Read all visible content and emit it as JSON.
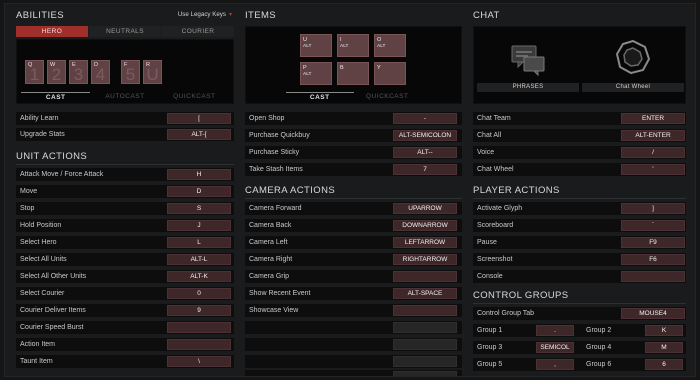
{
  "abilities": {
    "title": "ABILITIES",
    "legacy_label": "Use Legacy Keys",
    "tabs": [
      "HERO",
      "NEUTRALS",
      "COURIER"
    ],
    "slots": [
      {
        "key": "Q",
        "num": "1"
      },
      {
        "key": "W",
        "num": "2"
      },
      {
        "key": "E",
        "num": "3"
      },
      {
        "key": "D",
        "num": "4"
      },
      {
        "key": "F",
        "num": "5"
      },
      {
        "key": "R",
        "num": "U"
      }
    ],
    "modes": [
      "CAST",
      "AUTOCAST",
      "QUICKCAST"
    ],
    "rows": [
      {
        "label": "Ability Learn",
        "key": "["
      },
      {
        "label": "Upgrade Stats",
        "key": "ALT-["
      }
    ]
  },
  "unit_actions": {
    "title": "UNIT ACTIONS",
    "rows": [
      {
        "label": "Attack Move / Force Attack",
        "key": "H"
      },
      {
        "label": "Move",
        "key": "D"
      },
      {
        "label": "Stop",
        "key": "S"
      },
      {
        "label": "Hold Position",
        "key": "J"
      },
      {
        "label": "Select Hero",
        "key": "L"
      },
      {
        "label": "Select All Units",
        "key": "ALT-L"
      },
      {
        "label": "Select All Other Units",
        "key": "ALT-K"
      },
      {
        "label": "Select Courier",
        "key": "0"
      },
      {
        "label": "Courier Deliver Items",
        "key": "9"
      },
      {
        "label": "Courier Speed Burst",
        "key": ""
      },
      {
        "label": "Action Item",
        "key": ""
      },
      {
        "label": "Taunt Item",
        "key": "\\"
      }
    ]
  },
  "items": {
    "title": "ITEMS",
    "slots": [
      {
        "key": "U",
        "mod": "ALT"
      },
      {
        "key": "I",
        "mod": "ALT"
      },
      {
        "key": "O",
        "mod": "ALT"
      },
      {
        "key": "P",
        "mod": "ALT"
      },
      {
        "key": "B",
        "mod": ""
      },
      {
        "key": "Y",
        "mod": ""
      }
    ],
    "modes": [
      "CAST",
      "QUICKCAST"
    ],
    "rows": [
      {
        "label": "Open Shop",
        "key": "-"
      },
      {
        "label": "Purchase Quickbuy",
        "key": "ALT-SEMICOLON"
      },
      {
        "label": "Purchase Sticky",
        "key": "ALT--"
      },
      {
        "label": "Take Stash Items",
        "key": "7"
      }
    ]
  },
  "camera_actions": {
    "title": "CAMERA ACTIONS",
    "rows": [
      {
        "label": "Camera Forward",
        "key": "UPARROW"
      },
      {
        "label": "Camera Back",
        "key": "DOWNARROW"
      },
      {
        "label": "Camera Left",
        "key": "LEFTARROW"
      },
      {
        "label": "Camera Right",
        "key": "RIGHTARROW"
      },
      {
        "label": "Camera Grip",
        "key": ""
      },
      {
        "label": "Show Recent Event",
        "key": "ALT-SPACE"
      },
      {
        "label": "Showcase View",
        "key": ""
      },
      {
        "label": "",
        "key": ""
      },
      {
        "label": "",
        "key": ""
      },
      {
        "label": "",
        "key": ""
      },
      {
        "label": "",
        "key": ""
      }
    ]
  },
  "chat": {
    "title": "CHAT",
    "buttons": [
      "PHRASES",
      "Chat Wheel"
    ],
    "rows": [
      {
        "label": "Chat Team",
        "key": "ENTER"
      },
      {
        "label": "Chat All",
        "key": "ALT-ENTER"
      },
      {
        "label": "Voice",
        "key": "/"
      },
      {
        "label": "Chat Wheel",
        "key": "'"
      }
    ]
  },
  "player_actions": {
    "title": "PLAYER ACTIONS",
    "rows": [
      {
        "label": "Activate Glyph",
        "key": "]"
      },
      {
        "label": "Scoreboard",
        "key": "`"
      },
      {
        "label": "Pause",
        "key": "F9"
      },
      {
        "label": "Screenshot",
        "key": "F6"
      },
      {
        "label": "Console",
        "key": ""
      }
    ]
  },
  "control_groups": {
    "title": "CONTROL GROUPS",
    "tab_row": {
      "label": "Control Group Tab",
      "key": "MOUSE4"
    },
    "groups": [
      {
        "label": "Group 1",
        "key": "."
      },
      {
        "label": "Group 2",
        "key": "K"
      },
      {
        "label": "Group 3",
        "key": "SEMICOL"
      },
      {
        "label": "Group 4",
        "key": "M"
      },
      {
        "label": "Group 5",
        "key": ","
      },
      {
        "label": "Group 6",
        "key": "6"
      }
    ]
  },
  "colors": {
    "accent": "#a02f2b",
    "key_bg": "#3e2729",
    "slot_bg": "#604245"
  }
}
